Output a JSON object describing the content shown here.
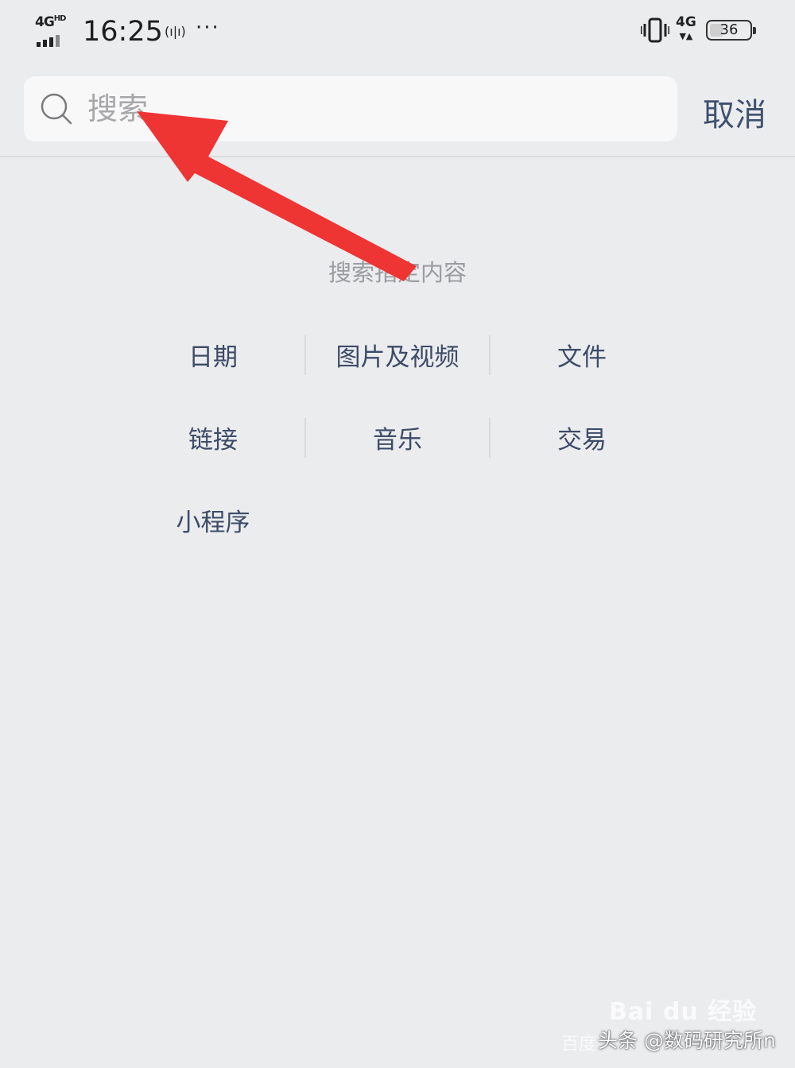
{
  "status_bar": {
    "network_type": "4G",
    "network_hd": "HD",
    "time": "16:25",
    "vibrate_glyph": "(ı|ı)",
    "more_dots": "···",
    "data_type": "4G",
    "battery_level": "36",
    "icons": [
      "signal-icon",
      "vibrate-icon",
      "battery-icon"
    ]
  },
  "search": {
    "placeholder": "搜索",
    "value": "",
    "cancel_label": "取消"
  },
  "section_hint": "搜索指定内容",
  "categories": [
    [
      "日期",
      "图片及视频",
      "文件"
    ],
    [
      "链接",
      "音乐",
      "交易"
    ],
    [
      "小程序"
    ]
  ],
  "colors": {
    "background": "#ebecee",
    "category_text": "#3d4b68",
    "cancel_text": "#3f5070",
    "annotation_arrow": "#ef3434"
  },
  "watermarks": {
    "baidu_logo": "Bai du 经验",
    "baidu_sub": "百度",
    "credit": "头条 @数码研究所n"
  }
}
